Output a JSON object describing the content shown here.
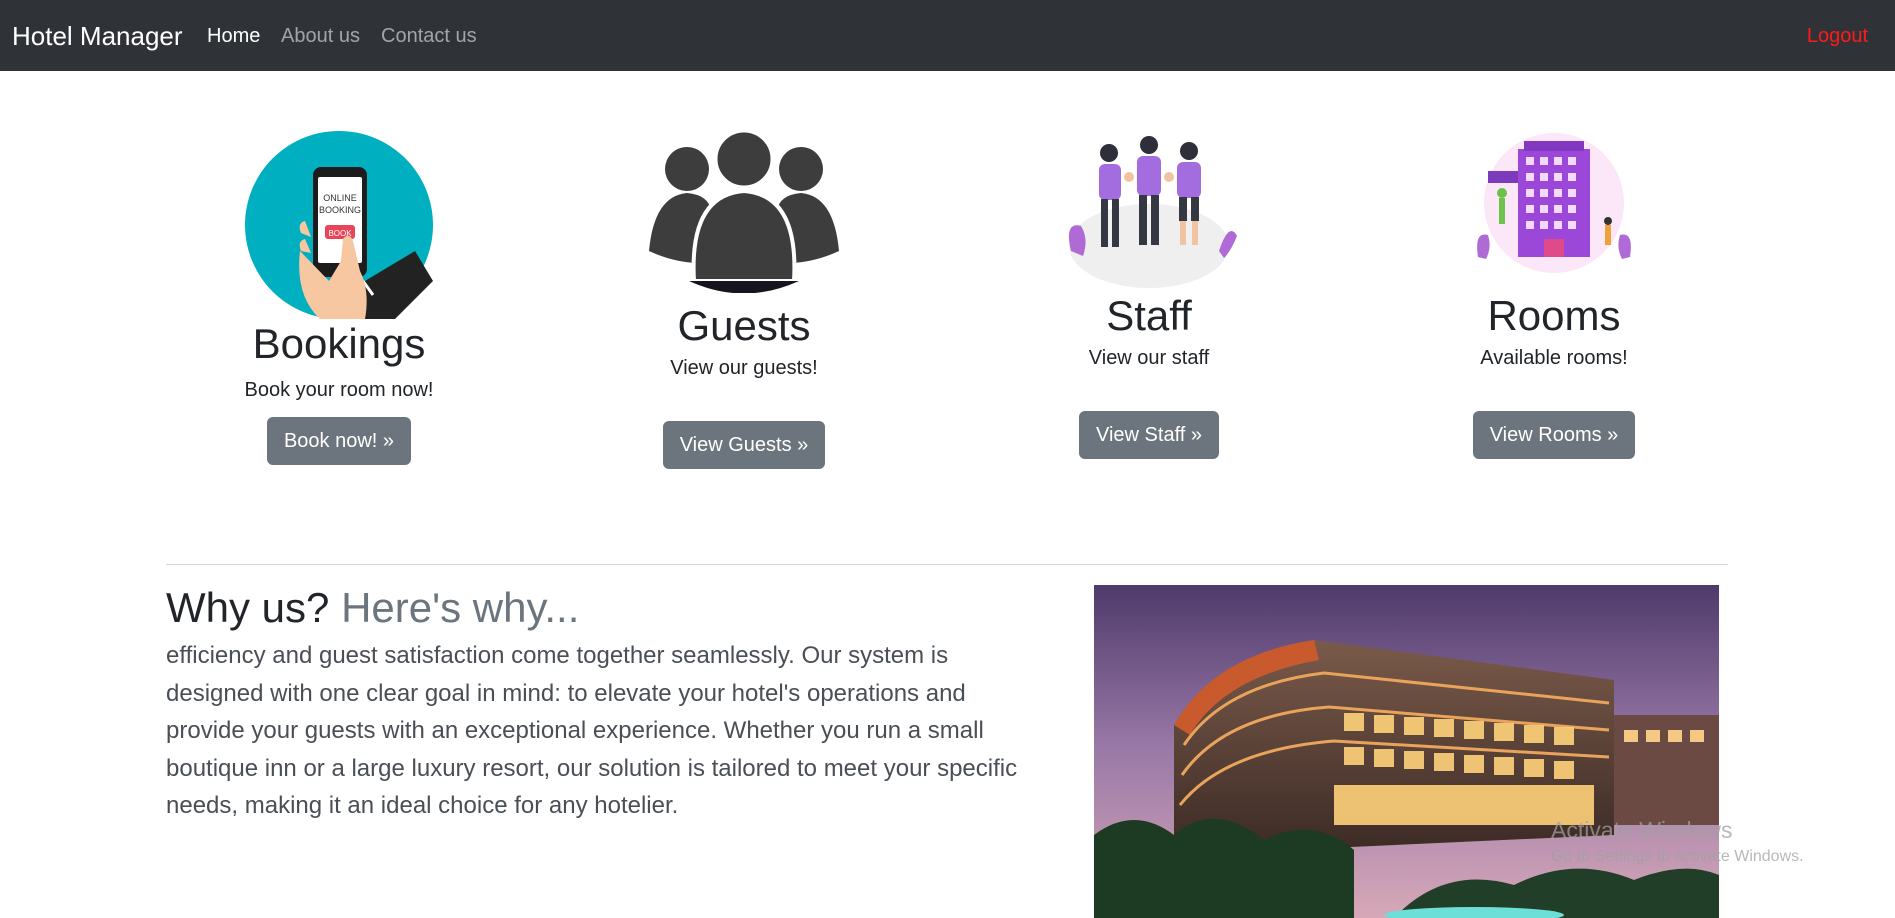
{
  "navbar": {
    "brand": "Hotel Manager",
    "links": [
      "Home",
      "About us",
      "Contact us"
    ],
    "logout": "Logout"
  },
  "features": [
    {
      "icon": "online-booking-icon",
      "title": "Bookings",
      "subtitle": "Book your room now!",
      "button": "Book now! »"
    },
    {
      "icon": "guests-group-icon",
      "title": "Guests",
      "subtitle": "View our guests!",
      "button": "View Guests »"
    },
    {
      "icon": "staff-team-icon",
      "title": "Staff",
      "subtitle": "View our staff",
      "button": "View Staff »"
    },
    {
      "icon": "hotel-building-icon",
      "title": "Rooms",
      "subtitle": "Available rooms!",
      "button": "View Rooms »"
    }
  ],
  "booking_icon_text": {
    "line1": "ONLINE",
    "line2": "BOOKING",
    "book": "BOOK"
  },
  "why": {
    "title": "Why us?",
    "subtitle": "Here's why...",
    "body": "efficiency and guest satisfaction come together seamlessly. Our system is designed with one clear goal in mind: to elevate your hotel's operations and provide your guests with an exceptional experience. Whether you run a small boutique inn or a large luxury resort, our solution is tailored to meet your specific needs, making it an ideal choice for any hotelier."
  },
  "watermark": {
    "line1": "Activate Windows",
    "line2": "Go to Settings to activate Windows."
  },
  "colors": {
    "navbar_bg": "#2f3338",
    "logout": "#ff1a1a",
    "button_bg": "#6c757d",
    "icon_teal": "#00b0c0",
    "icon_purple": "#9b59d6"
  }
}
